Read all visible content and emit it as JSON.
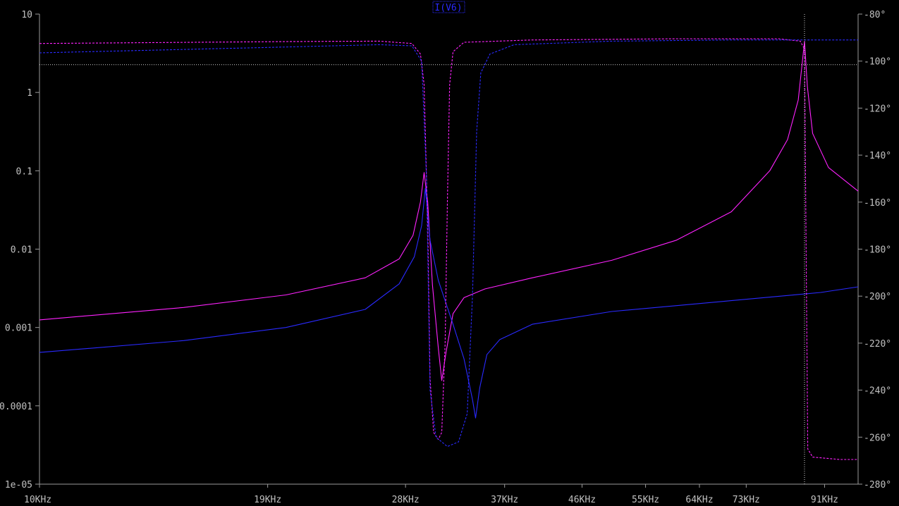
{
  "chart_data": {
    "type": "line",
    "xscale": "log",
    "yscale_left": "log",
    "xlim": [
      10000,
      100000
    ],
    "ylim_left": [
      1e-05,
      10
    ],
    "ylim_right": [
      -280,
      -80
    ],
    "x_ticks": [
      {
        "value": 10000,
        "label": "10KHz"
      },
      {
        "value": 19000,
        "label": "19KHz"
      },
      {
        "value": 28000,
        "label": "28KHz"
      },
      {
        "value": 37000,
        "label": "37KHz"
      },
      {
        "value": 46000,
        "label": "46KHz"
      },
      {
        "value": 55000,
        "label": "55KHz"
      },
      {
        "value": 64000,
        "label": "64KHz"
      },
      {
        "value": 73000,
        "label": "73KHz"
      },
      {
        "value": 91000,
        "label": "91KHz"
      }
    ],
    "y_ticks_left": [
      {
        "value": 10,
        "label": "10"
      },
      {
        "value": 1,
        "label": "1"
      },
      {
        "value": 0.1,
        "label": "0.1"
      },
      {
        "value": 0.01,
        "label": "0.01"
      },
      {
        "value": 0.001,
        "label": "0.001"
      },
      {
        "value": 0.0001,
        "label": "0.0001"
      },
      {
        "value": 1e-05,
        "label": "1e-05"
      }
    ],
    "y_ticks_right": [
      {
        "value": -80,
        "label": "-80°"
      },
      {
        "value": -100,
        "label": "-100°"
      },
      {
        "value": -120,
        "label": "-120°"
      },
      {
        "value": -140,
        "label": "-140°"
      },
      {
        "value": -160,
        "label": "-160°"
      },
      {
        "value": -180,
        "label": "-180°"
      },
      {
        "value": -200,
        "label": "-200°"
      },
      {
        "value": -220,
        "label": "-220°"
      },
      {
        "value": -240,
        "label": "-240°"
      },
      {
        "value": -260,
        "label": "-260°"
      },
      {
        "value": -280,
        "label": "-280°"
      }
    ],
    "trace_label": "I(V6)",
    "cursor": {
      "x": 86000,
      "phase": -101.5
    },
    "series": [
      {
        "color": "#ff22ff",
        "style": "solid",
        "axis": "left",
        "points": [
          [
            10000,
            0.00125
          ],
          [
            15000,
            0.0018
          ],
          [
            20000,
            0.0026
          ],
          [
            25000,
            0.0043
          ],
          [
            27500,
            0.0075
          ],
          [
            28600,
            0.015
          ],
          [
            29200,
            0.04
          ],
          [
            29500,
            0.095
          ],
          [
            29800,
            0.04
          ],
          [
            30200,
            0.0035
          ],
          [
            30700,
            0.00055
          ],
          [
            31000,
            0.00021
          ],
          [
            31400,
            0.0005
          ],
          [
            32000,
            0.0015
          ],
          [
            33000,
            0.0024
          ],
          [
            35000,
            0.0031
          ],
          [
            40000,
            0.0043
          ],
          [
            50000,
            0.0072
          ],
          [
            60000,
            0.013
          ],
          [
            70000,
            0.03
          ],
          [
            78000,
            0.1
          ],
          [
            82000,
            0.25
          ],
          [
            84500,
            0.8
          ],
          [
            85500,
            2.5
          ],
          [
            86000,
            4.5
          ],
          [
            86700,
            1.2
          ],
          [
            88000,
            0.3
          ],
          [
            92000,
            0.11
          ],
          [
            100000,
            0.055
          ]
        ]
      },
      {
        "color": "#2a2aff",
        "style": "solid",
        "axis": "left",
        "points": [
          [
            10000,
            0.00048
          ],
          [
            15000,
            0.00068
          ],
          [
            20000,
            0.001
          ],
          [
            25000,
            0.0017
          ],
          [
            27500,
            0.0036
          ],
          [
            28700,
            0.008
          ],
          [
            29300,
            0.02
          ],
          [
            29600,
            0.06
          ],
          [
            30000,
            0.013
          ],
          [
            30700,
            0.004
          ],
          [
            32000,
            0.0011
          ],
          [
            33000,
            0.0004
          ],
          [
            33800,
            0.00012
          ],
          [
            34100,
            7e-05
          ],
          [
            34500,
            0.00017
          ],
          [
            35200,
            0.00045
          ],
          [
            36500,
            0.0007
          ],
          [
            40000,
            0.0011
          ],
          [
            50000,
            0.0016
          ],
          [
            60000,
            0.0019
          ],
          [
            70000,
            0.0022
          ],
          [
            80000,
            0.0025
          ],
          [
            90000,
            0.0028
          ],
          [
            100000,
            0.0033
          ]
        ]
      },
      {
        "color": "#ff22ff",
        "style": "dashed",
        "axis": "right",
        "points": [
          [
            10000,
            -92.5
          ],
          [
            20000,
            -91.7
          ],
          [
            26000,
            -91.5
          ],
          [
            28500,
            -92.5
          ],
          [
            29200,
            -97
          ],
          [
            29500,
            -110
          ],
          [
            29800,
            -170
          ],
          [
            30000,
            -235
          ],
          [
            30300,
            -258
          ],
          [
            30700,
            -261
          ],
          [
            31000,
            -258
          ],
          [
            31300,
            -220
          ],
          [
            31500,
            -160
          ],
          [
            31700,
            -110
          ],
          [
            32000,
            -96
          ],
          [
            33000,
            -92
          ],
          [
            40000,
            -91
          ],
          [
            60000,
            -90.5
          ],
          [
            80000,
            -90.5
          ],
          [
            85000,
            -91.5
          ],
          [
            86000,
            -95
          ],
          [
            86400,
            -180
          ],
          [
            86800,
            -265
          ],
          [
            88000,
            -268.5
          ],
          [
            95000,
            -269.5
          ],
          [
            100000,
            -269.5
          ]
        ]
      },
      {
        "color": "#2a2aff",
        "style": "dashed",
        "axis": "right",
        "points": [
          [
            10000,
            -96.5
          ],
          [
            20000,
            -94
          ],
          [
            26000,
            -93
          ],
          [
            28500,
            -93.5
          ],
          [
            29300,
            -100
          ],
          [
            29700,
            -150
          ],
          [
            30000,
            -240
          ],
          [
            30500,
            -260
          ],
          [
            31500,
            -264
          ],
          [
            32500,
            -262
          ],
          [
            33300,
            -250
          ],
          [
            33800,
            -200
          ],
          [
            34200,
            -130
          ],
          [
            34600,
            -105
          ],
          [
            35500,
            -97
          ],
          [
            38000,
            -93
          ],
          [
            50000,
            -91.5
          ],
          [
            70000,
            -91
          ],
          [
            100000,
            -91
          ]
        ]
      }
    ]
  }
}
